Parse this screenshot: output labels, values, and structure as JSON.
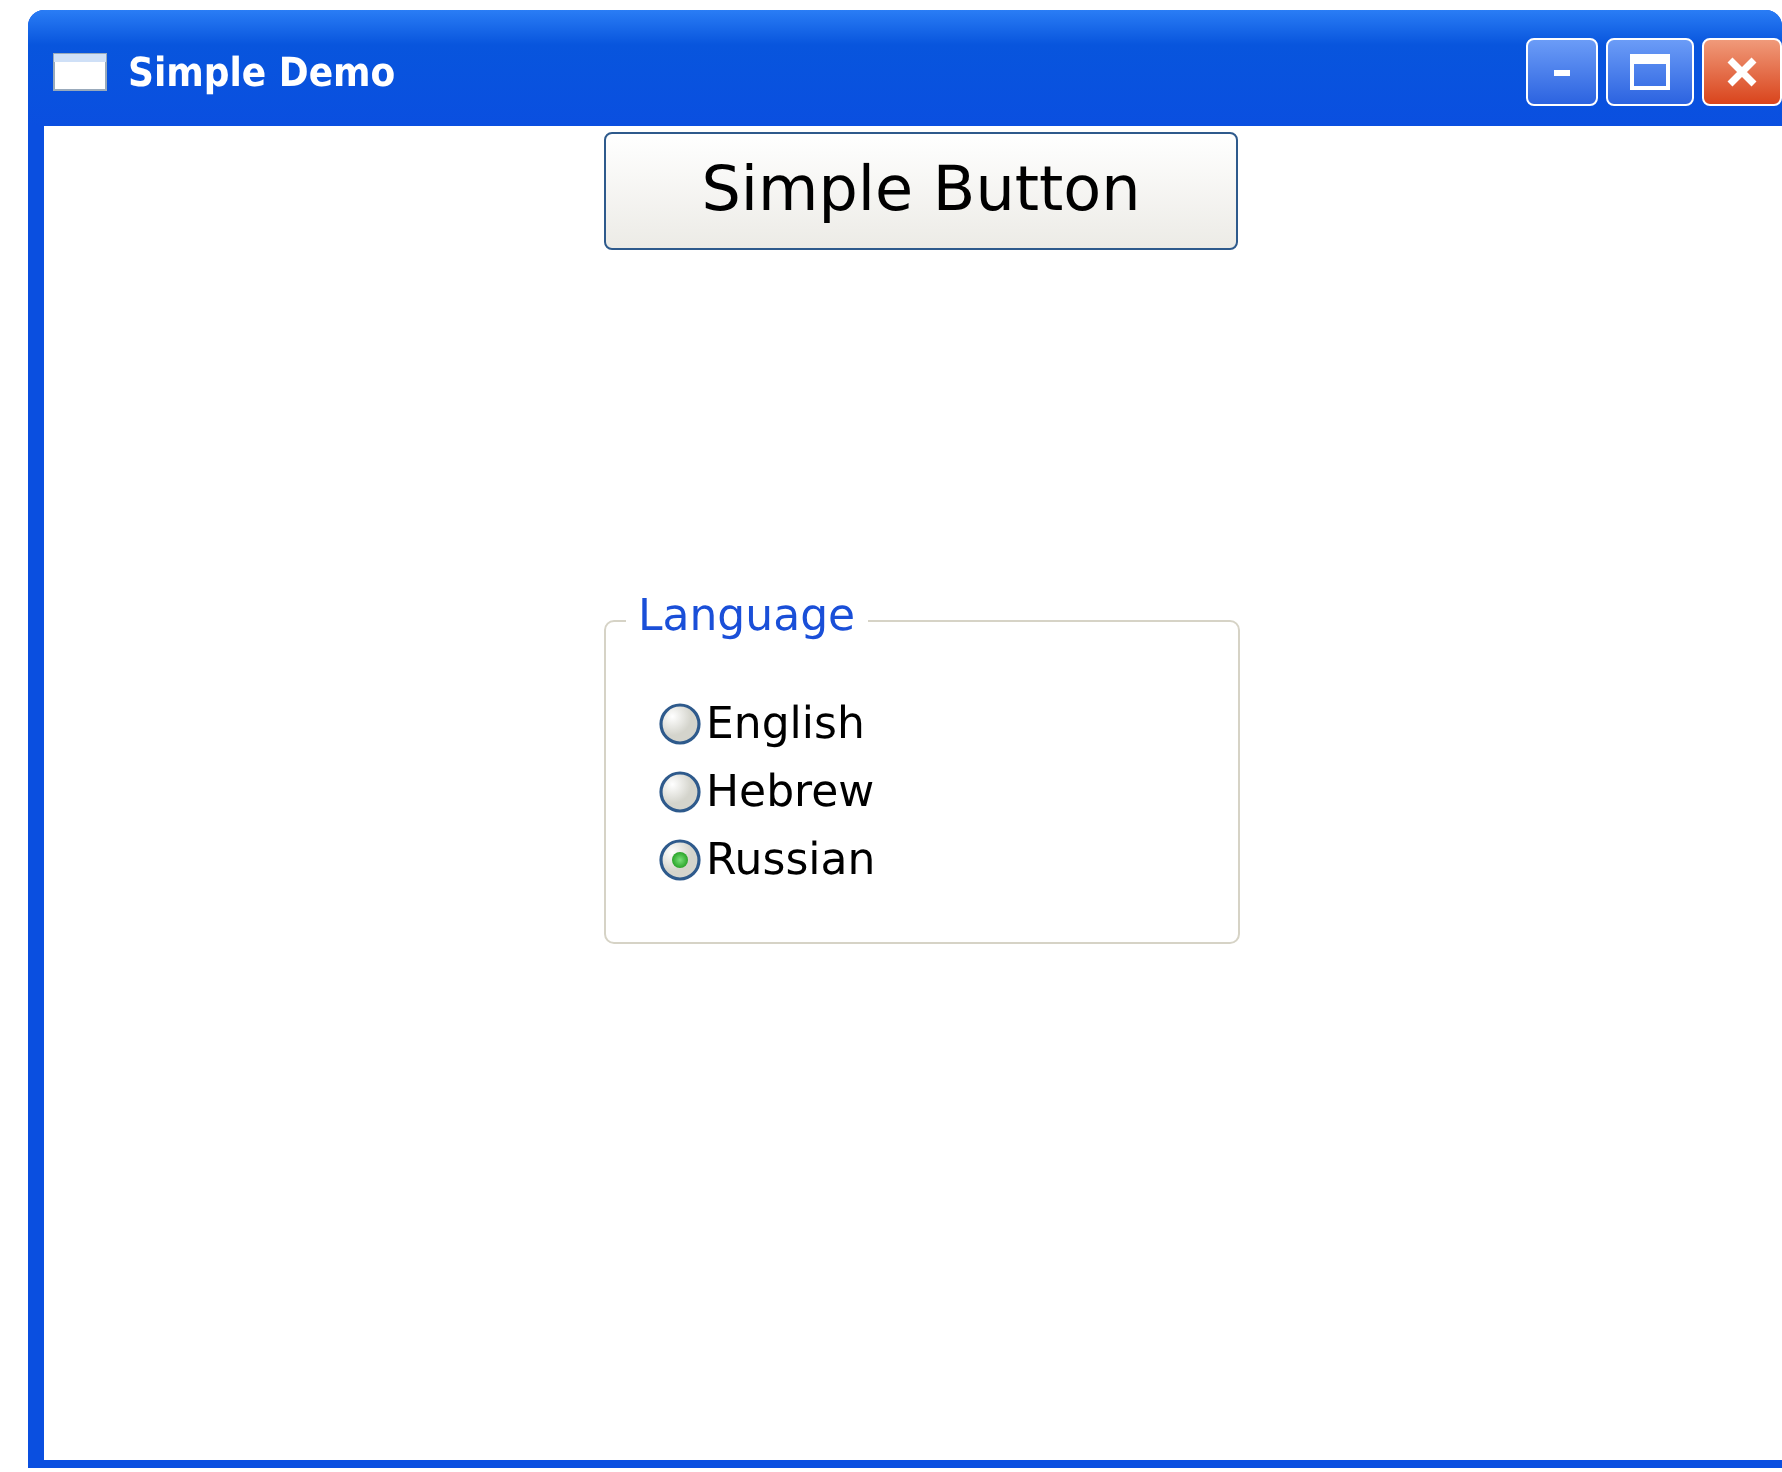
{
  "window": {
    "title": "Simple Demo"
  },
  "button": {
    "label": "Simple Button"
  },
  "group": {
    "legend": "Language",
    "options": [
      {
        "label": "English",
        "selected": false
      },
      {
        "label": "Hebrew",
        "selected": false
      },
      {
        "label": "Russian",
        "selected": true
      }
    ]
  }
}
